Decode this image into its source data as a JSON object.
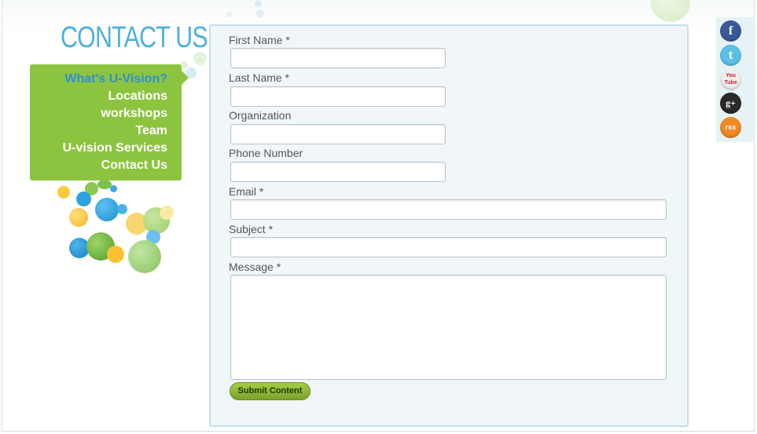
{
  "header": {
    "title": "CONTACT US"
  },
  "nav": {
    "items": [
      {
        "label": "What's U-Vision?",
        "active": true
      },
      {
        "label": "Locations"
      },
      {
        "label": "workshops"
      },
      {
        "label": "Team"
      },
      {
        "label": "U-vision Services"
      },
      {
        "label": "Contact Us"
      }
    ]
  },
  "form": {
    "first_name_label": "First Name *",
    "last_name_label": "Last Name *",
    "organization_label": "Organization",
    "phone_label": "Phone Number",
    "email_label": "Email *",
    "subject_label": "Subject *",
    "message_label": "Message *",
    "submit_label": "Submit Content"
  },
  "social": {
    "facebook": {
      "icon": "facebook-icon",
      "glyph": "f",
      "color": "#3b5998"
    },
    "twitter": {
      "icon": "twitter-icon",
      "glyph": "t",
      "color": "#5bc0e8"
    },
    "youtube": {
      "icon": "youtube-icon",
      "glyph": "You Tube",
      "color": "#e8e8e8"
    },
    "googleplus": {
      "icon": "google-plus-icon",
      "glyph": "g+",
      "color": "#2a2a2a"
    },
    "rss": {
      "icon": "rss-icon",
      "glyph": "rss",
      "color": "#f08a24"
    }
  },
  "colors": {
    "brand_blue": "#4fb0dc",
    "nav_green": "#8cc43f",
    "active_link": "#2f8fd2",
    "panel_bg": "#f1f6f9",
    "submit_green": "#7aa22a"
  }
}
